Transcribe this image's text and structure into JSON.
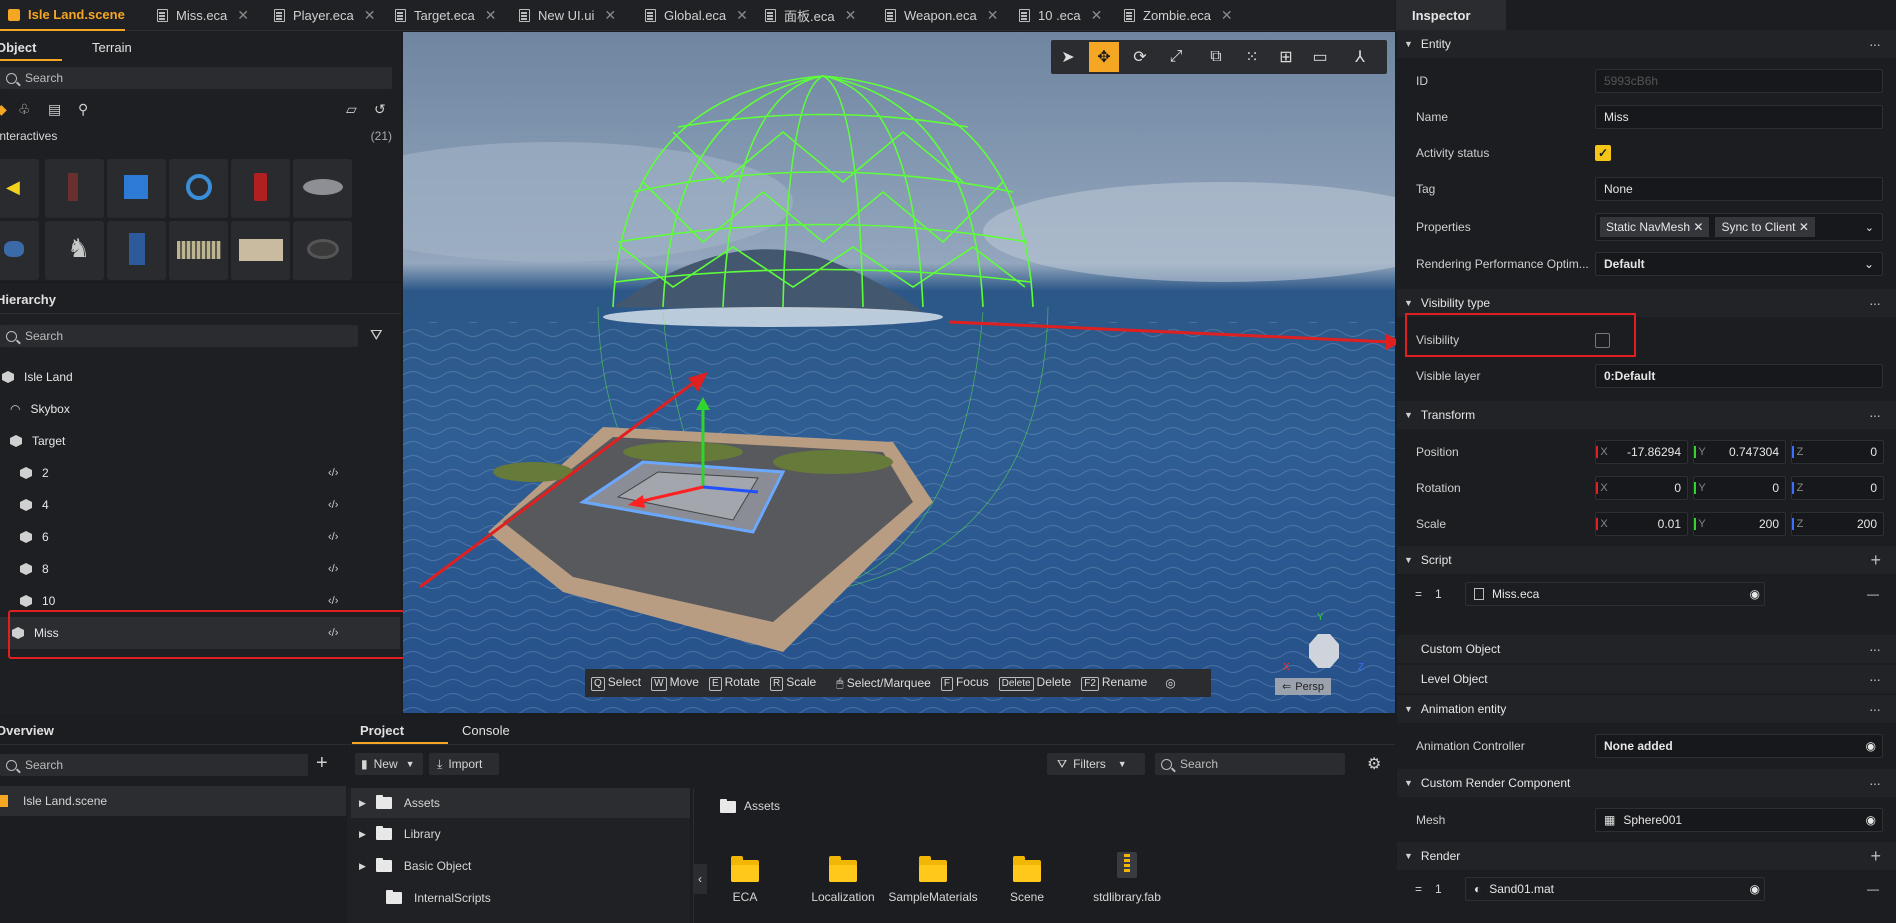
{
  "tabs": [
    {
      "label": "Isle Land.scene",
      "active": true
    },
    {
      "label": "Miss.eca"
    },
    {
      "label": "Player.eca"
    },
    {
      "label": "Target.eca"
    },
    {
      "label": "New UI.ui"
    },
    {
      "label": "Global.eca"
    },
    {
      "label": "面板.eca"
    },
    {
      "label": "Weapon.eca"
    },
    {
      "label": "10 .eca"
    },
    {
      "label": "Zombie.eca"
    }
  ],
  "object_panel": {
    "tabs": [
      "Object",
      "Terrain"
    ],
    "search_placeholder": "Search",
    "category": "Interactives",
    "count": "(21)"
  },
  "hierarchy": {
    "title": "Hierarchy",
    "search_placeholder": "Search",
    "items": [
      {
        "label": "Isle Land"
      },
      {
        "label": "Skybox"
      },
      {
        "label": "Target"
      },
      {
        "label": "2"
      },
      {
        "label": "4"
      },
      {
        "label": "6"
      },
      {
        "label": "8"
      },
      {
        "label": "10"
      },
      {
        "label": "Miss"
      }
    ],
    "code_glyph": "‹/›"
  },
  "overview": {
    "title": "Overview",
    "search_placeholder": "Search",
    "item": "Isle Land.scene"
  },
  "project": {
    "tabs": [
      "Project",
      "Console"
    ],
    "new_label": "New",
    "import_label": "Import",
    "filters_label": "Filters",
    "search_placeholder": "Search",
    "tree": [
      "Assets",
      "Library",
      "Basic Object",
      "InternalScripts"
    ],
    "breadcrumb": "Assets",
    "files": [
      "ECA",
      "Localization",
      "SampleMaterials",
      "Scene",
      "stdlibrary.fab"
    ]
  },
  "viewport": {
    "hints": [
      {
        "key": "Q",
        "label": "Select"
      },
      {
        "key": "W",
        "label": "Move"
      },
      {
        "key": "E",
        "label": "Rotate"
      },
      {
        "key": "R",
        "label": "Scale"
      },
      {
        "key": "🖱",
        "label": "Select/Marquee"
      },
      {
        "key": "F",
        "label": "Focus"
      },
      {
        "key": "Delete",
        "label": "Delete"
      },
      {
        "key": "F2",
        "label": "Rename"
      }
    ],
    "persp": "Persp",
    "axis_y": "Y",
    "axis_x": "X",
    "axis_z": "Z"
  },
  "inspector": {
    "title": "Inspector",
    "entity": {
      "section": "Entity",
      "id_label": "ID",
      "id_value": "5993cB6h",
      "name_label": "Name",
      "name_value": "Miss",
      "activity_label": "Activity status",
      "tag_label": "Tag",
      "tag_value": "None",
      "properties_label": "Properties",
      "prop1": "Static NavMesh",
      "prop2": "Sync to Client",
      "render_perf_label": "Rendering Performance Optim...",
      "render_perf_value": "Default"
    },
    "visibility": {
      "section": "Visibility type",
      "visibility_label": "Visibility",
      "layer_label": "Visible layer",
      "layer_value": "0:Default"
    },
    "transform": {
      "section": "Transform",
      "position_label": "Position",
      "position": [
        "-17.86294",
        "0.747304",
        "0"
      ],
      "rotation_label": "Rotation",
      "rotation": [
        "0",
        "0",
        "0"
      ],
      "scale_label": "Scale",
      "scale": [
        "0.01",
        "200",
        "200"
      ]
    },
    "script": {
      "section": "Script",
      "index": "1",
      "file": "Miss.eca"
    },
    "sections": [
      "Custom Object",
      "Level Object",
      "Animation entity"
    ],
    "animation": {
      "controller_label": "Animation Controller",
      "controller_value": "None added"
    },
    "crc": {
      "section": "Custom Render Component",
      "mesh_label": "Mesh",
      "mesh_value": "Sphere001"
    },
    "render": {
      "section": "Render",
      "index": "1",
      "material": "Sand01.mat"
    }
  },
  "colors": {
    "accent": "#f5a623",
    "highlight": "#e02020",
    "sphere": "#5dff3a"
  }
}
